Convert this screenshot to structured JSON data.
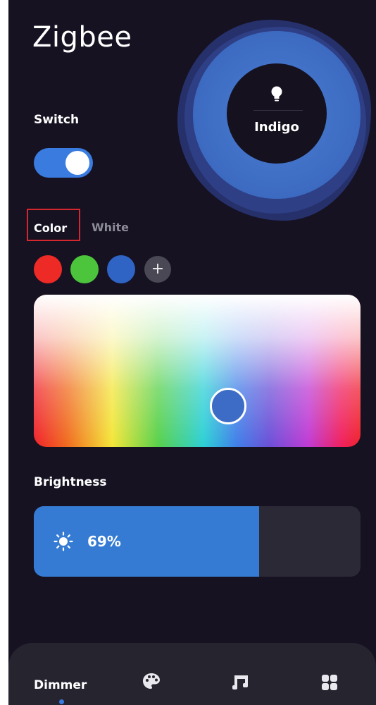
{
  "app": {
    "title": "Zigbee"
  },
  "hero": {
    "color_name": "Indigo",
    "bulb_icon": "lightbulb-icon"
  },
  "switch": {
    "label": "Switch",
    "state": "on"
  },
  "color_tabs": [
    {
      "label": "Color",
      "selected": true
    },
    {
      "label": "White",
      "selected": false
    }
  ],
  "swatches": [
    {
      "name": "red",
      "color": "#ee2a26"
    },
    {
      "name": "green",
      "color": "#4cc43b"
    },
    {
      "name": "blue",
      "color": "#2f63c4"
    }
  ],
  "add_swatch_symbol": "+",
  "picker": {
    "selected_color": "#3c6cc6"
  },
  "brightness": {
    "label": "Brightness",
    "value_text": "69%",
    "value": 0.69
  },
  "bottom_nav": {
    "items": [
      {
        "label": "Dimmer",
        "icon": "dimmer",
        "active": true
      },
      {
        "label": "",
        "icon": "palette-icon",
        "active": false
      },
      {
        "label": "",
        "icon": "music-icon",
        "active": false
      },
      {
        "label": "",
        "icon": "grid-icon",
        "active": false
      }
    ]
  },
  "colors": {
    "background": "#161222",
    "accent": "#3a7be0",
    "tab_highlight": "#d6262e"
  }
}
